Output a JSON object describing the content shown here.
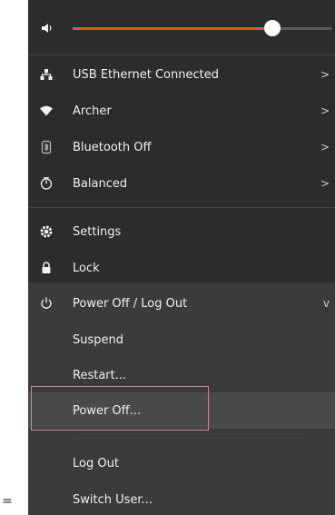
{
  "prefix_char": "=",
  "volume": {
    "icon": "speaker-icon",
    "level": 0.77,
    "accent": "#e95420"
  },
  "network_items": [
    {
      "label": "USB Ethernet Connected",
      "icon": "network-wired-icon",
      "chevron": ">"
    },
    {
      "label": "Archer",
      "icon": "wifi-icon",
      "chevron": ">"
    },
    {
      "label": "Bluetooth Off",
      "icon": "bluetooth-icon",
      "chevron": ">"
    },
    {
      "label": "Balanced",
      "icon": "power-profile-icon",
      "chevron": ">"
    }
  ],
  "settings": {
    "label": "Settings",
    "icon": "gear-icon"
  },
  "lock": {
    "label": "Lock",
    "icon": "lock-icon"
  },
  "power": {
    "label": "Power Off / Log Out",
    "icon": "power-icon",
    "chevron": "v",
    "items": [
      "Suspend",
      "Restart...",
      "Power Off...",
      "Log Out",
      "Switch User..."
    ]
  },
  "colors": {
    "menu_bg": "#2c2c2c",
    "submenu_bg": "#3b3b3b",
    "focus_border": "#d4889c"
  }
}
